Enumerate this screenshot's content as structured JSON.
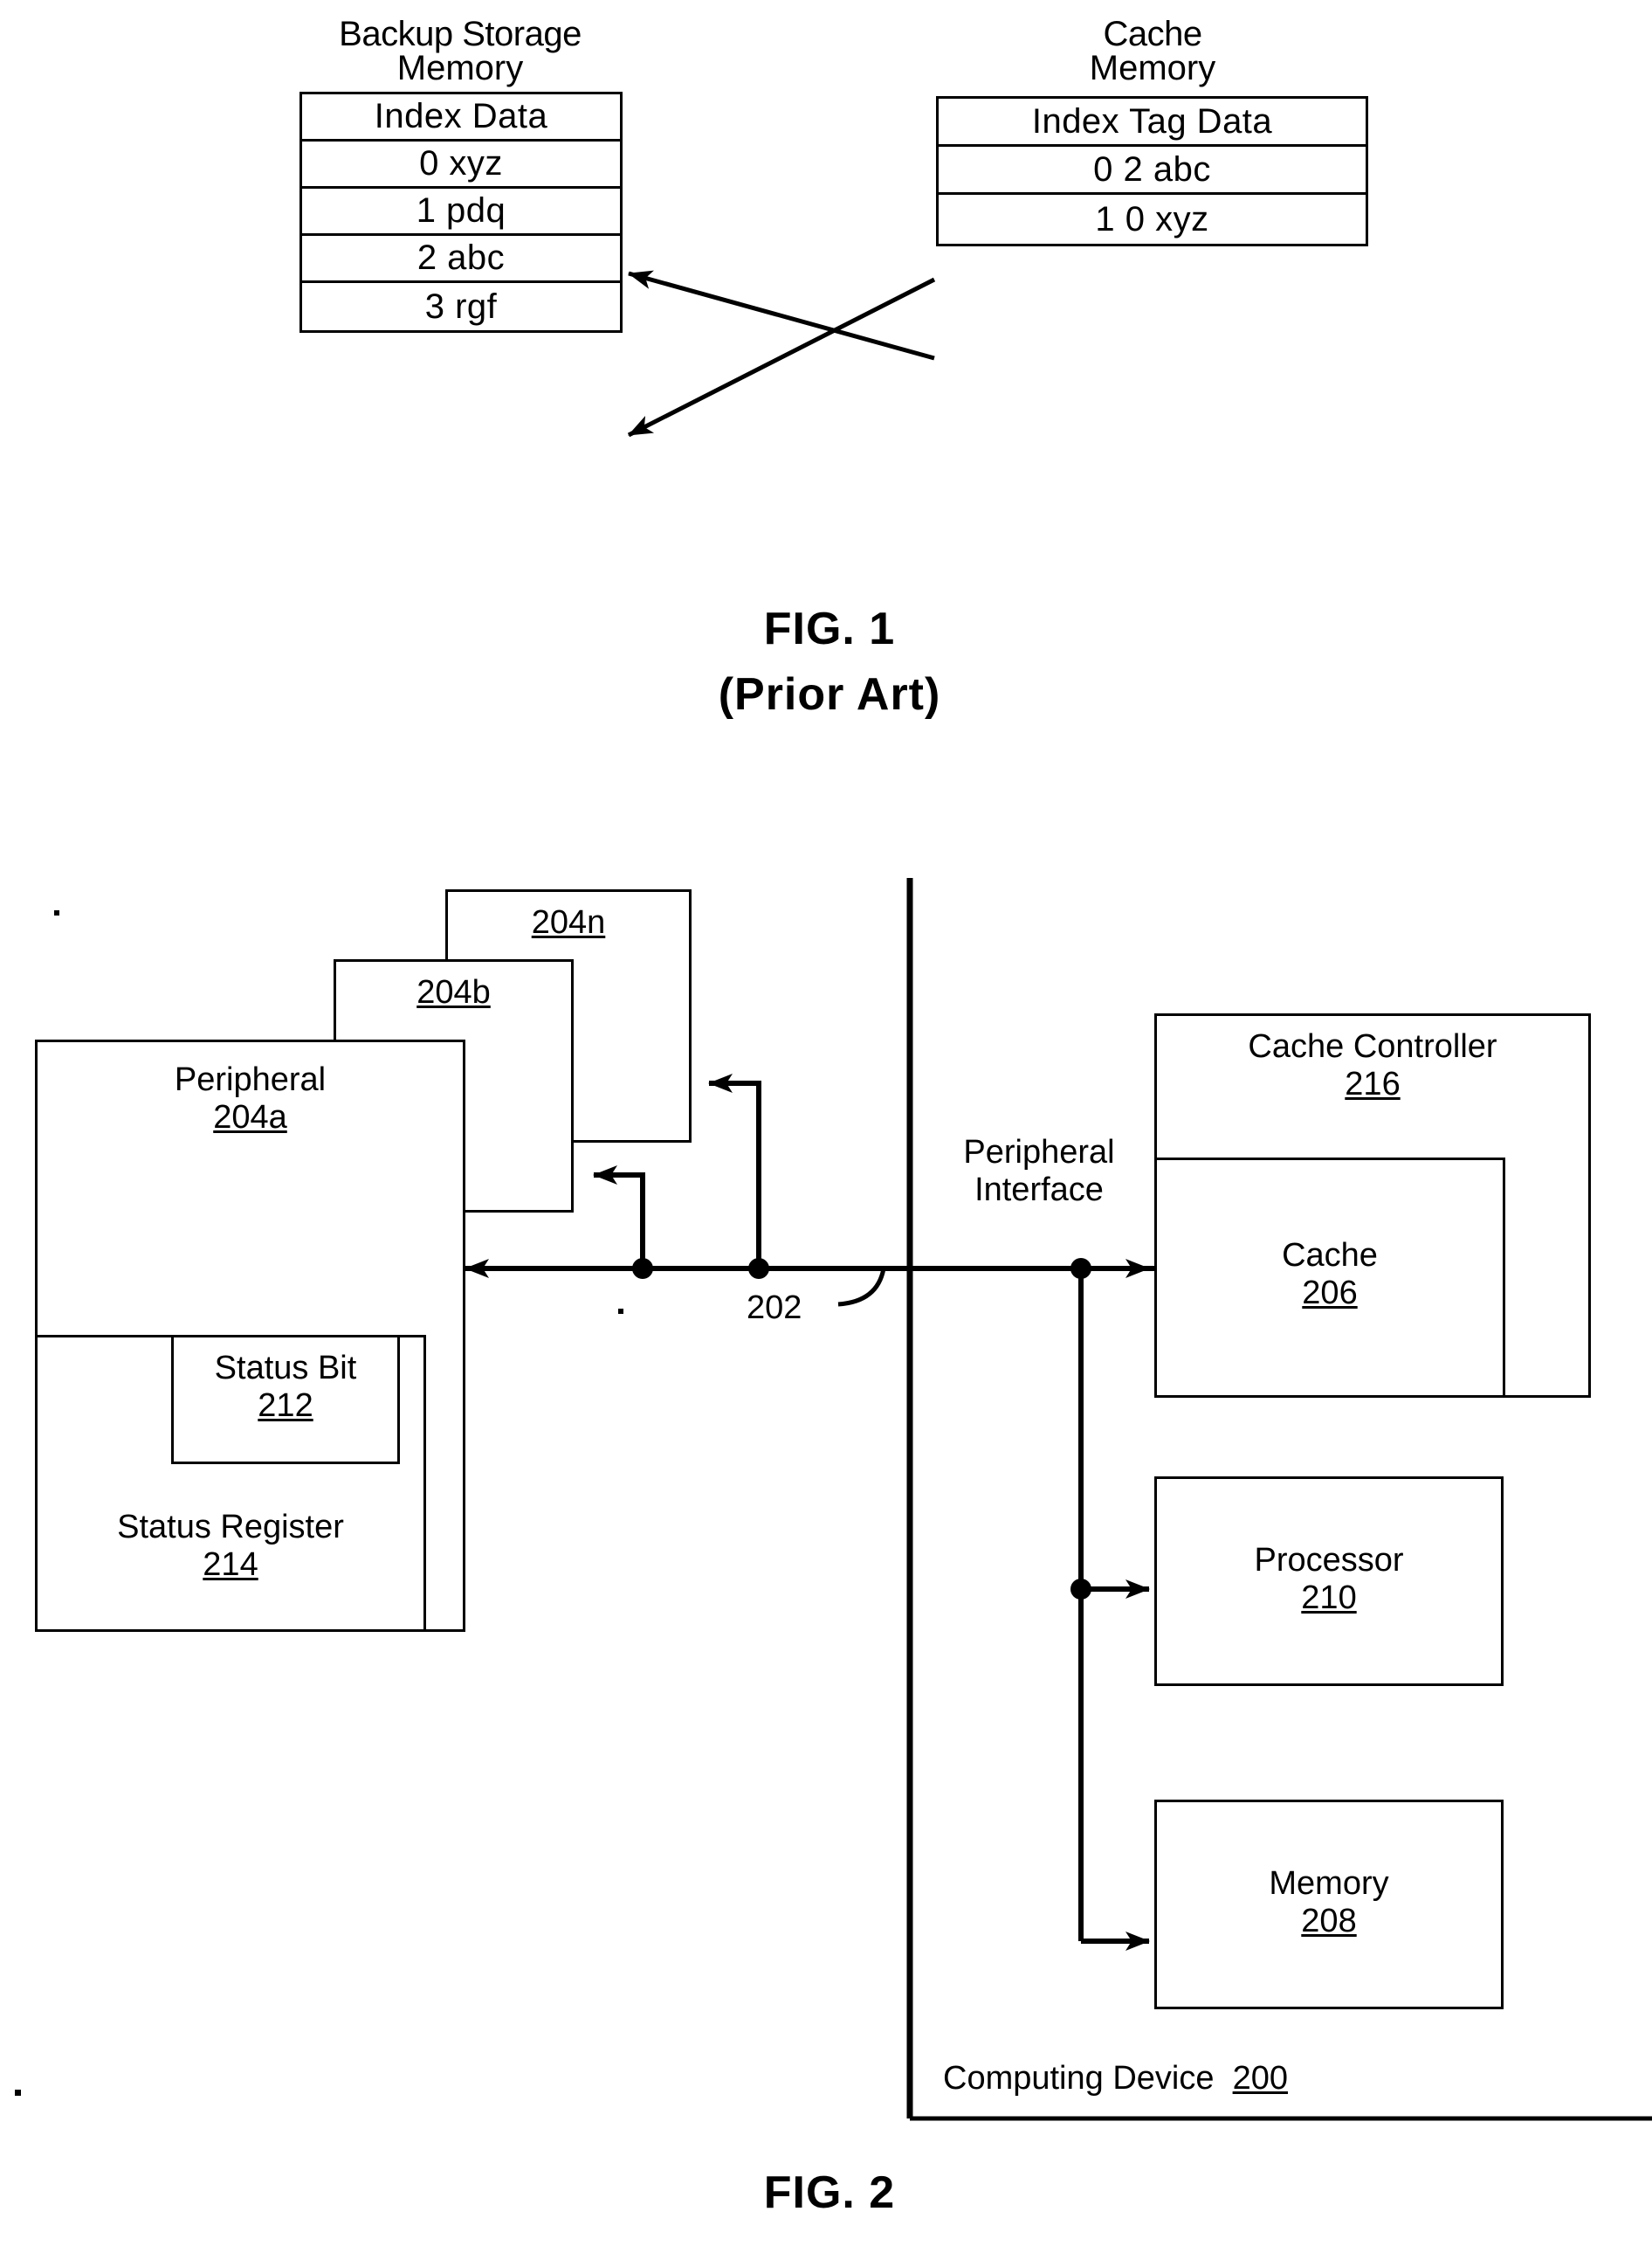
{
  "figure1": {
    "caption_line1": "FIG. 1",
    "caption_line2": "(Prior Art)",
    "backup_storage": {
      "title_line1": "Backup Storage",
      "title_line2": "Memory",
      "header": "Index Data",
      "rows": [
        "0 xyz",
        "1 pdq",
        "2 abc",
        "3 rgf"
      ]
    },
    "cache_memory": {
      "title_line1": "Cache",
      "title_line2": "Memory",
      "header": "Index Tag Data",
      "rows": [
        "0  2   abc",
        "1  0   xyz"
      ]
    }
  },
  "figure2": {
    "caption": "FIG. 2",
    "peripherals": [
      {
        "name": "Peripheral",
        "ref": "204a"
      },
      {
        "name": "",
        "ref": "204b"
      },
      {
        "name": "",
        "ref": "204n"
      }
    ],
    "status_bit": {
      "name": "Status Bit",
      "ref": "212"
    },
    "status_register": {
      "name": "Status Register",
      "ref": "214"
    },
    "bus_ref": "202",
    "peripheral_interface": {
      "line1": "Peripheral",
      "line2": "Interface"
    },
    "cache_controller": {
      "name": "Cache Controller",
      "ref": "216"
    },
    "cache": {
      "name": "Cache",
      "ref": "206"
    },
    "processor": {
      "name": "Processor",
      "ref": "210"
    },
    "memory": {
      "name": "Memory",
      "ref": "208"
    },
    "computing_device": {
      "name": "Computing Device",
      "ref": "200"
    }
  }
}
